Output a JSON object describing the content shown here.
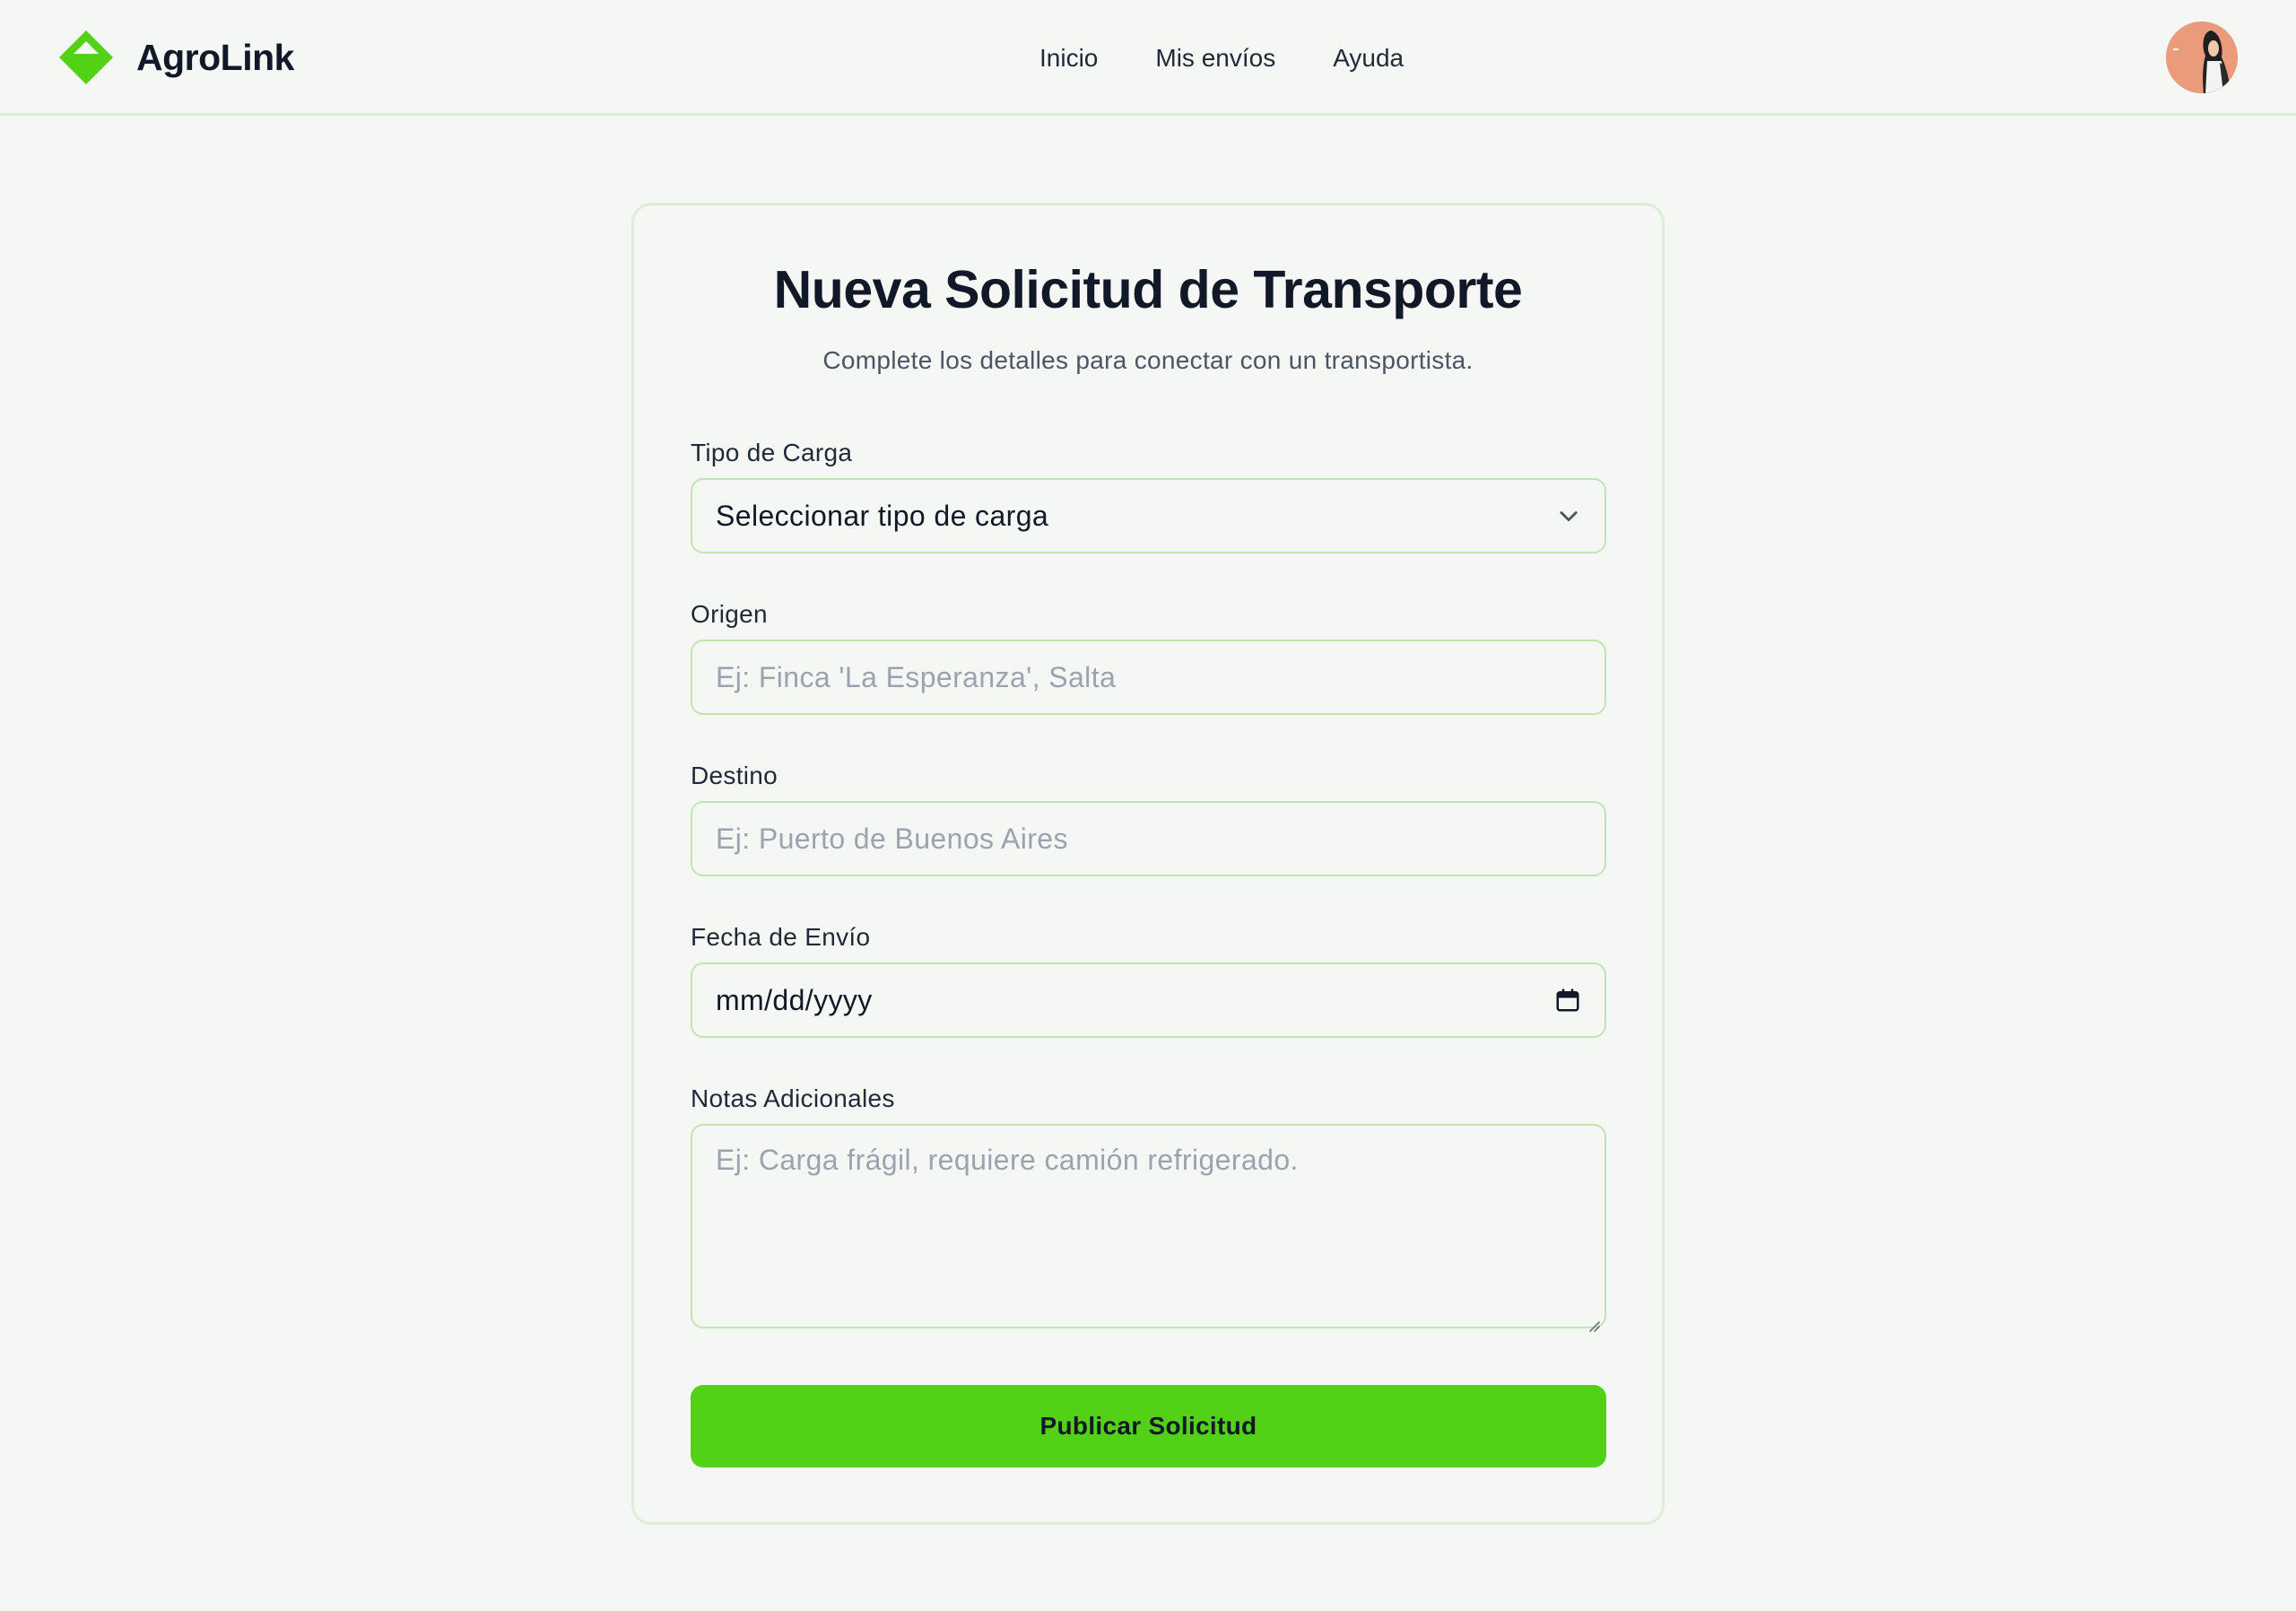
{
  "header": {
    "brand_name": "AgroLink",
    "logo_icon": "diamond-logo-icon",
    "nav": [
      "Inicio",
      "Mis envíos",
      "Ayuda"
    ],
    "avatar_icon": "user-avatar-icon"
  },
  "form": {
    "title": "Nueva Solicitud de Transporte",
    "subtitle": "Complete los detalles para conectar con un transportista.",
    "cargo_type": {
      "label": "Tipo de Carga",
      "value": "Seleccionar tipo de carga",
      "icon": "chevron-down-icon"
    },
    "origin": {
      "label": "Origen",
      "placeholder": "Ej: Finca 'La Esperanza', Salta"
    },
    "destination": {
      "label": "Destino",
      "placeholder": "Ej: Puerto de Buenos Aires"
    },
    "ship_date": {
      "label": "Fecha de Envío",
      "value": "mm/dd/yyyy",
      "icon": "calendar-icon"
    },
    "notes": {
      "label": "Notas Adicionales",
      "placeholder": "Ej: Carga frágil, requiere camión refrigerado."
    },
    "submit_label": "Publicar Solicitud"
  },
  "colors": {
    "accent": "#52d116",
    "border": "#bfe6b1",
    "background": "#f5f7f5"
  }
}
